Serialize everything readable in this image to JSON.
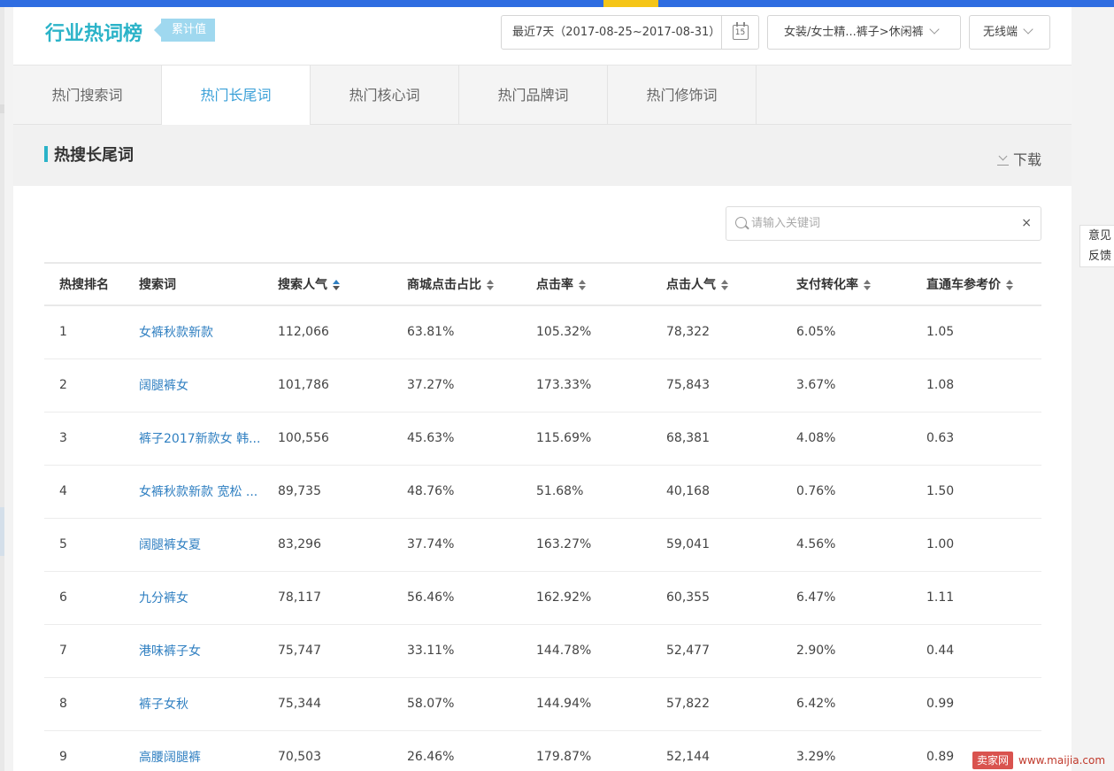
{
  "header": {
    "title": "行业热词榜",
    "badge": "累计值",
    "date_range": "最近7天（2017-08-25~2017-08-31）",
    "calendar_day": "15",
    "category": "女装/女士精...裤子>休闲裤",
    "device": "无线端"
  },
  "tabs": [
    {
      "label": "热门搜索词",
      "active": false
    },
    {
      "label": "热门长尾词",
      "active": true
    },
    {
      "label": "热门核心词",
      "active": false
    },
    {
      "label": "热门品牌词",
      "active": false
    },
    {
      "label": "热门修饰词",
      "active": false
    }
  ],
  "section": {
    "title": "热搜长尾词",
    "download_label": "下载"
  },
  "search": {
    "placeholder": "请输入关键词",
    "value": "",
    "clear_label": "×"
  },
  "table": {
    "columns": [
      "热搜排名",
      "搜索词",
      "搜索人气",
      "商城点击占比",
      "点击率",
      "点击人气",
      "支付转化率",
      "直通车参考价"
    ],
    "rows": [
      [
        "1",
        "女裤秋款新款",
        "112,066",
        "63.81%",
        "105.32%",
        "78,322",
        "6.05%",
        "1.05"
      ],
      [
        "2",
        "阔腿裤女",
        "101,786",
        "37.27%",
        "173.33%",
        "75,843",
        "3.67%",
        "1.08"
      ],
      [
        "3",
        "裤子2017新款女 韩...",
        "100,556",
        "45.63%",
        "115.69%",
        "68,381",
        "4.08%",
        "0.63"
      ],
      [
        "4",
        "女裤秋款新款 宽松 ...",
        "89,735",
        "48.76%",
        "51.68%",
        "40,168",
        "0.76%",
        "1.50"
      ],
      [
        "5",
        "阔腿裤女夏",
        "83,296",
        "37.74%",
        "163.27%",
        "59,041",
        "4.56%",
        "1.00"
      ],
      [
        "6",
        "九分裤女",
        "78,117",
        "56.46%",
        "162.92%",
        "60,355",
        "6.47%",
        "1.11"
      ],
      [
        "7",
        "港味裤子女",
        "75,747",
        "33.11%",
        "144.78%",
        "52,477",
        "2.90%",
        "0.44"
      ],
      [
        "8",
        "裤子女秋",
        "75,344",
        "58.07%",
        "144.94%",
        "57,822",
        "6.42%",
        "0.99"
      ],
      [
        "9",
        "高腰阔腿裤",
        "70,503",
        "26.46%",
        "179.87%",
        "52,144",
        "3.29%",
        "0.89"
      ]
    ]
  },
  "feedback": {
    "line1": "意见",
    "line2": "反馈"
  },
  "watermark": {
    "badge": "卖家网",
    "url": "www.maijia.com"
  },
  "colors": {
    "accent": "#2bb3c8",
    "link": "#2f7fc1",
    "topbar": "#2f6de1"
  }
}
